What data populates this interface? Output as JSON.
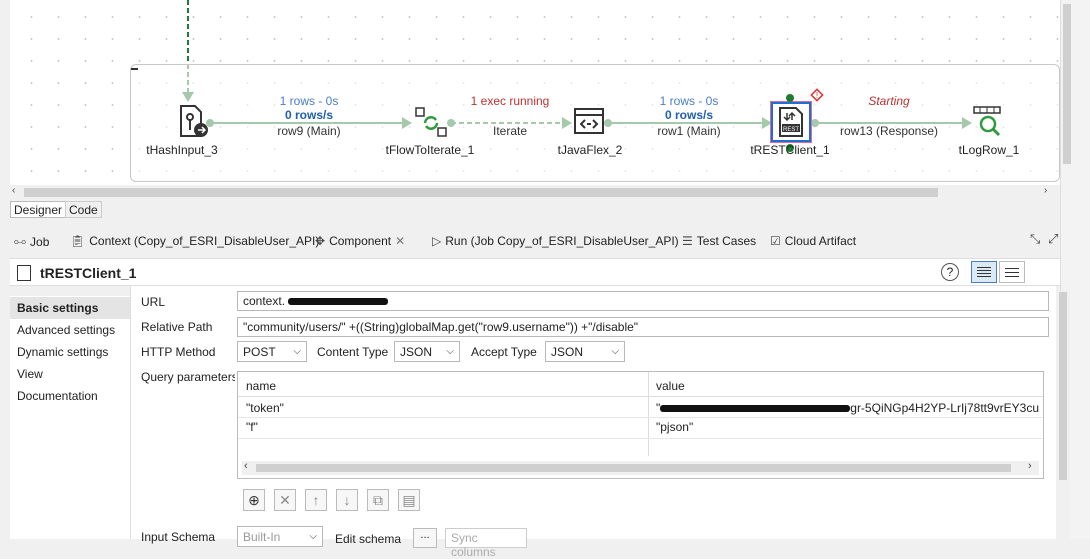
{
  "canvas": {
    "components": [
      {
        "label": "tHashInput_3"
      },
      {
        "label": "tFlowToIterate_1"
      },
      {
        "label": "tJavaFlex_2"
      },
      {
        "label": "tRESTClient_1"
      },
      {
        "label": "tLogRow_1"
      }
    ],
    "links": [
      {
        "status": "1 rows - 0s",
        "rate": "0 rows/s",
        "name": "row9 (Main)"
      },
      {
        "status": "1 exec running",
        "name": "Iterate"
      },
      {
        "status": "1 rows - 0s",
        "rate": "0 rows/s",
        "name": "row1 (Main)"
      },
      {
        "status": "Starting",
        "name": "row13 (Response)"
      }
    ]
  },
  "editor_tabs": {
    "designer": "Designer",
    "code": "Code"
  },
  "view_tabs": [
    {
      "label": "Job",
      "icon": "job-icon"
    },
    {
      "label": "Context (Copy_of_ESRI_DisableUser_API)",
      "icon": "context-icon"
    },
    {
      "label": "Component",
      "icon": "component-icon"
    },
    {
      "label": "Run (Job Copy_of_ESRI_DisableUser_API)",
      "icon": "run-icon"
    },
    {
      "label": "Test Cases",
      "icon": "test-cases-icon"
    },
    {
      "label": "Cloud Artifact",
      "icon": "cloud-artifact-icon"
    }
  ],
  "component": {
    "title": "tRESTClient_1"
  },
  "settings_nav": [
    {
      "label": "Basic settings"
    },
    {
      "label": "Advanced settings"
    },
    {
      "label": "Dynamic settings"
    },
    {
      "label": "View"
    },
    {
      "label": "Documentation"
    }
  ],
  "form": {
    "url_label": "URL",
    "url_value": "context.",
    "relative_path_label": "Relative Path",
    "relative_path_value": "\"community/users/\" +((String)globalMap.get(\"row9.username\")) +\"/disable\"",
    "http_method_label": "HTTP Method",
    "http_method_value": "POST",
    "content_type_label": "Content Type",
    "content_type_value": "JSON",
    "accept_type_label": "Accept Type",
    "accept_type_value": "JSON",
    "query_params_label": "Query parameters",
    "table": {
      "headers": [
        "name",
        "value"
      ],
      "rows": [
        {
          "name": "\"token\"",
          "value": "gr-5QiNGp4H2YP-LrIj78tt9vrEY3cu"
        },
        {
          "name": "\"f\"",
          "value": "\"pjson\""
        }
      ]
    },
    "input_schema_label": "Input Schema",
    "input_schema_value": "Built-In",
    "edit_schema_label": "Edit schema",
    "edit_schema_button": "...",
    "sync_columns_label": "Sync columns"
  }
}
